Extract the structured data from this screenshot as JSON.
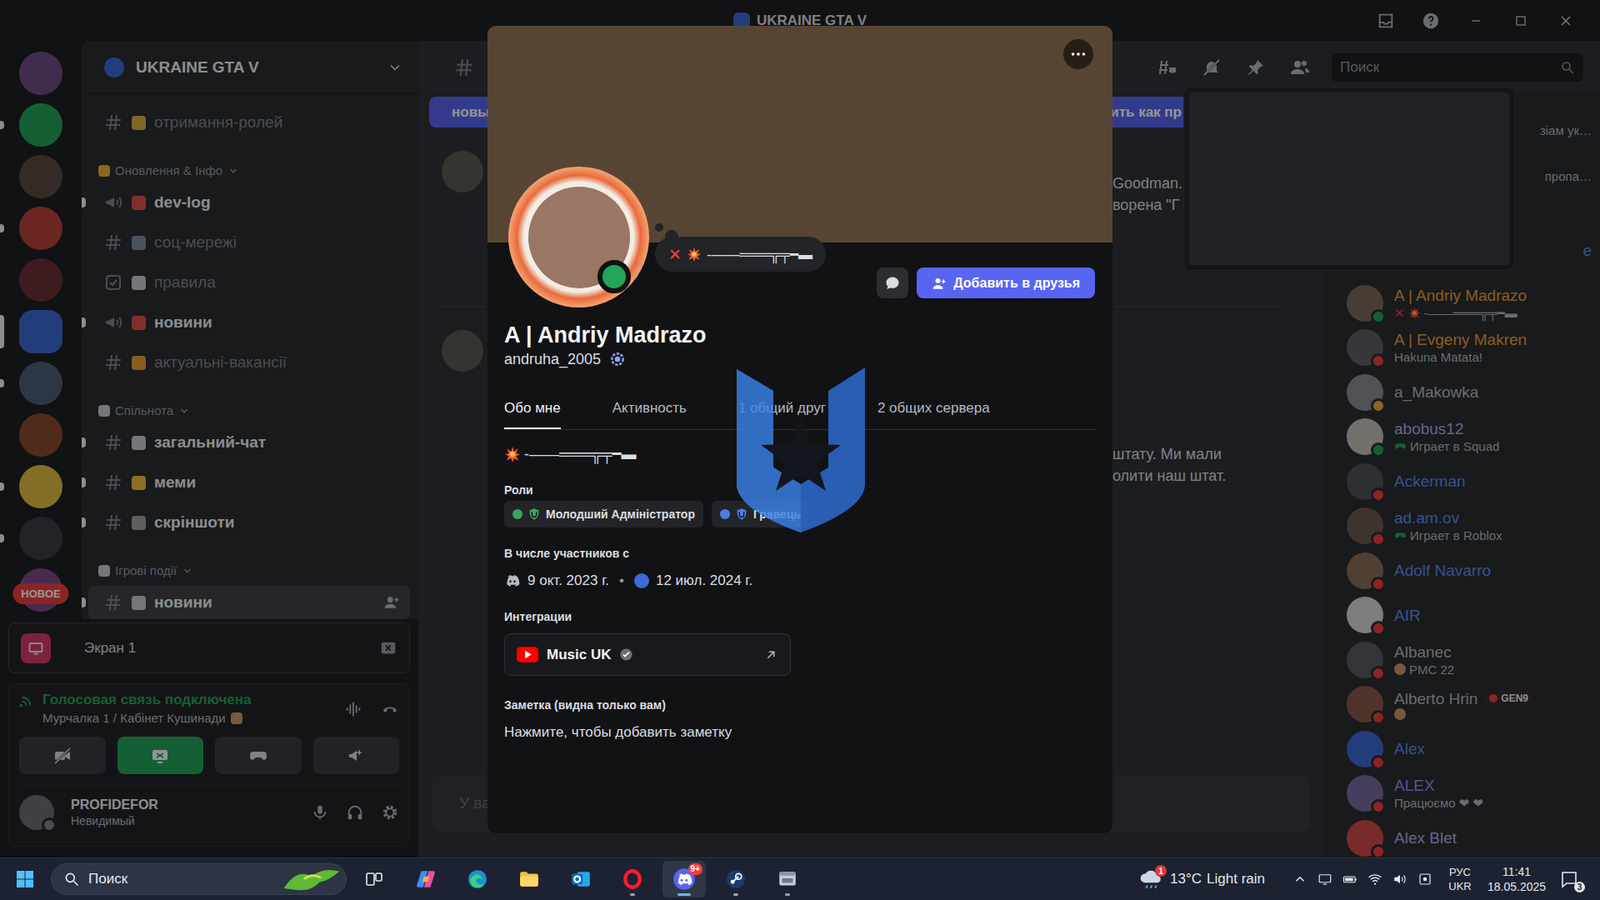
{
  "window": {
    "title": "UKRAINE GTA V"
  },
  "rail": {
    "new_badge": "НОВОЕ"
  },
  "servers": [
    {
      "color": "#6e4f86",
      "unread": false,
      "selected": false
    },
    {
      "color": "#23a55a",
      "unread": true,
      "selected": false
    },
    {
      "color": "#5b4a44",
      "unread": false,
      "selected": false
    },
    {
      "color": "#b8423c",
      "unread": true,
      "selected": false
    },
    {
      "color": "#6b2f36",
      "unread": false,
      "selected": false
    },
    {
      "color": "#3d6ad6",
      "unread": false,
      "selected": true
    },
    {
      "color": "#4d6079",
      "unread": true,
      "selected": false
    },
    {
      "color": "#8a4b2c",
      "unread": false,
      "selected": false
    },
    {
      "color": "#e0c040",
      "unread": true,
      "selected": false
    },
    {
      "color": "#3b3d44",
      "unread": true,
      "selected": false
    },
    {
      "color": "#7c4a86",
      "unread": false,
      "selected": false
    }
  ],
  "sidebar": {
    "server_name": "UKRAINE GTA V",
    "items": [
      {
        "kind": "channel",
        "type": "text",
        "name": "отримання-ролей",
        "color": "#e0b040",
        "unread": false,
        "selected": false
      },
      {
        "kind": "category",
        "name": "Оновлення & Інфо",
        "color": "#f0b232",
        "expanded": true
      },
      {
        "kind": "channel",
        "type": "announcement",
        "name": "dev-log",
        "color": "#e05050",
        "unread": true,
        "selected": false
      },
      {
        "kind": "channel",
        "type": "text",
        "name": "соц-мережі",
        "color": "#8090a0",
        "unread": false,
        "selected": false
      },
      {
        "kind": "channel",
        "type": "rules",
        "name": "правила",
        "color": "#c8ccd0",
        "unread": false,
        "selected": false
      },
      {
        "kind": "channel",
        "type": "announcement",
        "name": "новини",
        "color": "#e05050",
        "unread": true,
        "selected": false
      },
      {
        "kind": "channel",
        "type": "text",
        "name": "актуальні-вакансії",
        "color": "#f0a030",
        "unread": false,
        "selected": false
      },
      {
        "kind": "category",
        "name": "Спільнота",
        "color": "#c8ccd0",
        "expanded": true
      },
      {
        "kind": "channel",
        "type": "text",
        "name": "загальний-чат",
        "color": "#c8ccd0",
        "unread": true,
        "selected": false
      },
      {
        "kind": "channel",
        "type": "text",
        "name": "меми",
        "color": "#f0c040",
        "unread": true,
        "selected": false
      },
      {
        "kind": "channel",
        "type": "text",
        "name": "скріншоти",
        "color": "#a0a4a8",
        "unread": true,
        "selected": false
      },
      {
        "kind": "category",
        "name": "Ігрові події",
        "color": "#c8ccd0",
        "expanded": true
      },
      {
        "kind": "channel",
        "type": "text",
        "name": "новини",
        "color": "#c8ccd0",
        "unread": true,
        "selected": true
      }
    ]
  },
  "panels": {
    "screen_label": "Экран 1",
    "voice_status": "Голосовая связь подключена",
    "voice_channel": "Мурчалка 1 / Кабінет Кушинади",
    "buttons": [
      {
        "kind": "camera",
        "selected": false
      },
      {
        "kind": "screen",
        "selected": true
      },
      {
        "kind": "activity",
        "selected": false
      },
      {
        "kind": "soundboard",
        "selected": false
      }
    ]
  },
  "user": {
    "name": "PROFIDEFOR",
    "status_text": "Невидимый",
    "status": "offline"
  },
  "chat": {
    "search_placeholder": "Поиск",
    "banner": {
      "left": "новы",
      "right": "тить как пр"
    },
    "messages": [
      {
        "lines": [
          "Goodman.",
          "ворена \"Г"
        ]
      },
      {
        "lines": [
          "штату. Ми мали",
          "олити наш штат."
        ]
      }
    ],
    "input_placeholder": "У ва"
  },
  "member_fragments": [
    {
      "text": "зіам ук…",
      "link": false
    },
    {
      "text": "пропа…",
      "link": false
    },
    {
      "text": "е",
      "link": true
    }
  ],
  "members": [
    {
      "name": "A | Andriy Madrazo",
      "color": "#e8a33a",
      "status": "online",
      "activity": {
        "kind": "custom",
        "emoji": "✕",
        "text": "-——═══╦╤━▬"
      }
    },
    {
      "name": "A | Evgeny Makren",
      "color": "#e8a33a",
      "status": "dnd",
      "activity": {
        "kind": "text",
        "text": "Hakuna Matata!"
      }
    },
    {
      "name": "a_Makowka",
      "color": "#b5bac1",
      "status": "idle"
    },
    {
      "name": "abobus12",
      "color": "#a7b0f0",
      "status": "online",
      "activity": {
        "kind": "game",
        "text": "Играет в Squad"
      }
    },
    {
      "name": "Ackerman",
      "color": "#5b8def",
      "status": "dnd"
    },
    {
      "name": "ad.am.ov",
      "color": "#5b8def",
      "status": "dnd",
      "activity": {
        "kind": "game",
        "text": "Играет в Roblox"
      }
    },
    {
      "name": "Adolf Navarro",
      "color": "#5b8def",
      "status": "dnd"
    },
    {
      "name": "AIR",
      "color": "#5b8def",
      "status": "dnd"
    },
    {
      "name": "Albanec",
      "color": "#b5bac1",
      "status": "dnd",
      "activity": {
        "kind": "icon-text",
        "text": "PMC 22"
      }
    },
    {
      "name": "Alberto Hrin",
      "color": "#b5bac1",
      "status": "dnd",
      "tag": "GEN9",
      "activity": {
        "kind": "icon"
      }
    },
    {
      "name": "Alex",
      "color": "#5b8def",
      "status": "dnd"
    },
    {
      "name": "ALEX",
      "color": "#8f95f0",
      "status": "dnd",
      "activity": {
        "kind": "text",
        "text": "Працюємо ❤ ❤"
      }
    },
    {
      "name": "Alex Blet",
      "color": "#a7b0f0",
      "status": "dnd"
    }
  ],
  "profile": {
    "display_name": "A | Andriy Madrazo",
    "username": "andruha_2005",
    "status": "online",
    "custom_status": {
      "emoji": "✕",
      "text": "-——═══╦╤━▬"
    },
    "add_friend": "Добавить в друзья",
    "tabs": [
      {
        "label": "Обо мне",
        "selected": true
      },
      {
        "label": "Активность",
        "selected": false
      },
      {
        "label": "1 общий друг",
        "selected": false
      },
      {
        "label": "2 общих сервера",
        "selected": false
      }
    ],
    "bio": "-——═══╦╤━▬",
    "sections": {
      "roles": "Роли",
      "member_since": "В числе участников с",
      "integrations": "Интеграции",
      "note": "Заметка (видна только вам)"
    },
    "roles": [
      {
        "name": "Молодший Адміністратор",
        "color": "#3ba55c"
      },
      {
        "name": "Гравець",
        "color": "#4f7de0"
      }
    ],
    "member_since": {
      "discord": "9 окт. 2023 г.",
      "separator": "•",
      "server": "12 июл. 2024 г."
    },
    "integrations": [
      {
        "name": "Music UK",
        "verified": true
      }
    ],
    "note_placeholder": "Нажмите, чтобы добавить заметку"
  },
  "taskbar": {
    "search_placeholder": "Поиск",
    "apps": [
      {
        "kind": "taskview",
        "running": false,
        "selected": false
      },
      {
        "kind": "copilot",
        "running": false,
        "selected": false
      },
      {
        "kind": "edge",
        "running": false,
        "selected": false
      },
      {
        "kind": "explorer",
        "running": false,
        "selected": false
      },
      {
        "kind": "outlook",
        "running": false,
        "selected": false
      },
      {
        "kind": "opera",
        "running": true,
        "selected": false
      },
      {
        "kind": "discord",
        "running": true,
        "selected": true,
        "badge": "9+"
      },
      {
        "kind": "steam",
        "running": true,
        "selected": false
      },
      {
        "kind": "app",
        "running": true,
        "selected": false
      }
    ],
    "weather": {
      "temp": "13°C",
      "condition": "Light rain",
      "badge": "1"
    },
    "language": {
      "top": "РУС",
      "bottom": "UKR"
    },
    "time": "11:41",
    "date": "18.05.2025",
    "notifications": "3"
  }
}
